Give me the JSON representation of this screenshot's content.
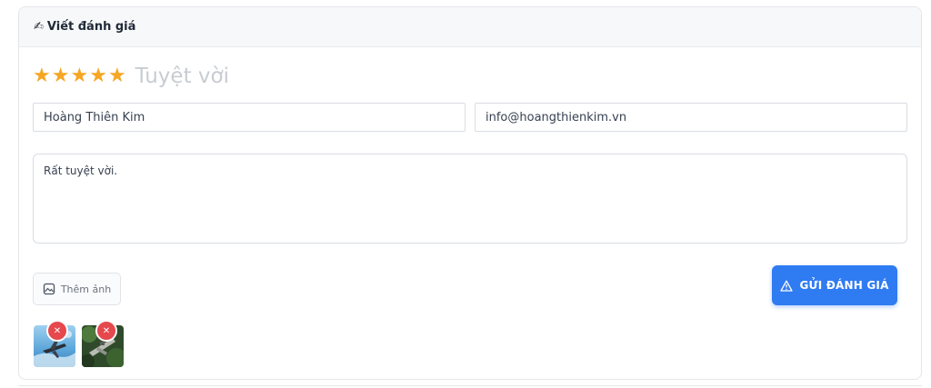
{
  "card": {
    "title": "Viết đánh giá",
    "title_icon": "pencil-icon"
  },
  "rating": {
    "stars": 5,
    "max": 5,
    "star_color": "#f5a623",
    "label": "Tuyệt vời"
  },
  "form": {
    "name_value": "Hoàng Thiên Kim",
    "email_value": "info@hoangthienkim.vn",
    "message_value": "Rất tuyệt vời."
  },
  "actions": {
    "add_photo_label": "Thêm ảnh",
    "add_photo_icon": "image-icon",
    "submit_label": "GỬI ĐÁNH GIÁ",
    "submit_icon": "warning-triangle-icon",
    "submit_color": "#2f7bf2"
  },
  "photos": [
    {
      "name": "photo-thumbnail-1",
      "remove_icon": "close-icon"
    },
    {
      "name": "photo-thumbnail-2",
      "remove_icon": "close-icon"
    }
  ]
}
